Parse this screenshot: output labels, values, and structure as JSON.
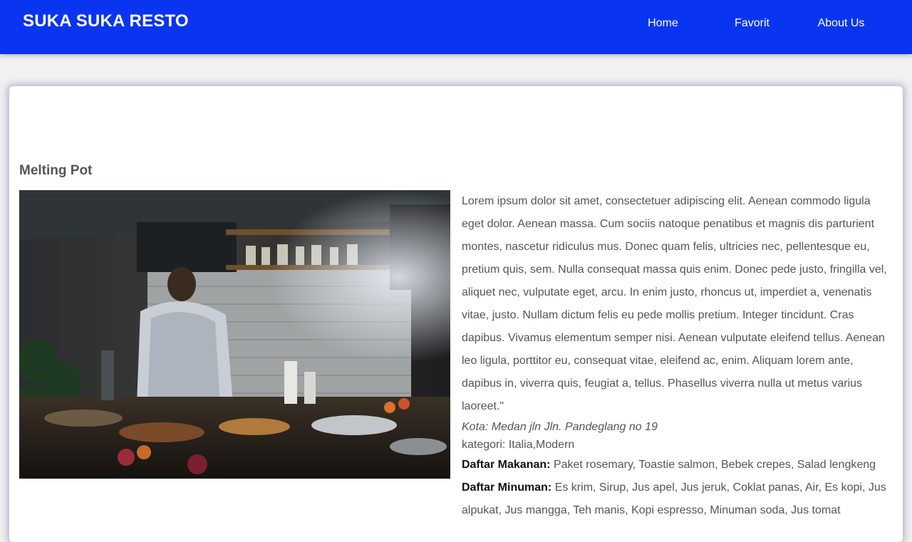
{
  "header": {
    "brand": "SUKA SUKA RESTO",
    "nav": [
      {
        "label": "Home"
      },
      {
        "label": "Favorit"
      },
      {
        "label": "About Us"
      }
    ]
  },
  "restaurant": {
    "name": "Melting Pot",
    "description": "Lorem ipsum dolor sit amet, consectetuer adipiscing elit. Aenean commodo ligula eget dolor. Aenean massa. Cum sociis natoque penatibus et magnis dis parturient montes, nascetur ridiculus mus. Donec quam felis, ultricies nec, pellentesque eu, pretium quis, sem. Nulla consequat massa quis enim. Donec pede justo, fringilla vel, aliquet nec, vulputate eget, arcu. In enim justo, rhoncus ut, imperdiet a, venenatis vitae, justo. Nullam dictum felis eu pede mollis pretium. Integer tincidunt. Cras dapibus. Vivamus elementum semper nisi. Aenean vulputate eleifend tellus. Aenean leo ligula, porttitor eu, consequat vitae, eleifend ac, enim. Aliquam lorem ante, dapibus in, viverra quis, feugiat a, tellus. Phasellus viverra nulla ut metus varius laoreet.\"",
    "city": "Kota: Medan jln Jln. Pandeglang no 19",
    "category": "kategori: Italia,Modern",
    "foods_label": "Daftar Makanan:",
    "foods": "Paket rosemary, Toastie salmon, Bebek crepes, Salad lengkeng",
    "drinks_label": "Daftar Minuman:",
    "drinks": "Es krim, Sirup, Jus apel, Jus jeruk, Coklat panas, Air, Es kopi, Jus alpukat, Jus mangga, Teh manis, Kopi espresso, Minuman soda, Jus tomat"
  },
  "colors": {
    "header_bg": "#0a35f0",
    "page_bg": "#f1f1f1",
    "card_bg": "#ffffff"
  }
}
